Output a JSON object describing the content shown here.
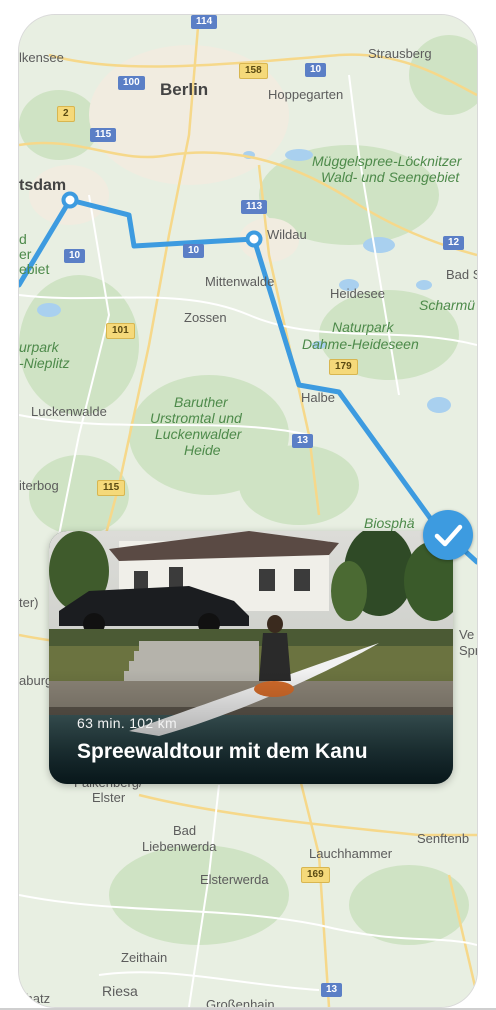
{
  "map": {
    "places": {
      "berlin": "Berlin",
      "falkensee": "lkensee",
      "strausberg": "Strausberg",
      "hoppegarten": "Hoppegarten",
      "muggelspree1": "Müggelspree-Löcknitzer",
      "muggelspree2": "Wald- und Seengebiet",
      "potsdam": "tsdam",
      "wildau": "Wildau",
      "mittenwalde": "Mittenwalde",
      "heidesee": "Heidesee",
      "badsa": "Bad S",
      "scharmu": "Scharmü",
      "zossen": "Zossen",
      "naturpark1": "Naturpark",
      "naturpark2": "Dahme-Heideseen",
      "nuthe1": "urpark",
      "nuthe2": "-Nieplitz",
      "luckenwalde": "Luckenwalde",
      "baruther1": "Baruther",
      "baruther2": "Urstromtal und",
      "baruther3": "Luckenwalder",
      "baruther4": "Heide",
      "halbe": "Halbe",
      "juterbog": "iterbog",
      "biosph": "Biosphä",
      "left_d": "d",
      "left_er": "er",
      "left_ebiet": "ebiet",
      "left_ter": "ter)",
      "left_burg": "aburg",
      "ve": "Ve",
      "spr": "Spr",
      "falkenberg": "Falkenberg/",
      "elster": "Elster",
      "bad": "Bad",
      "liebenwerda": "Liebenwerda",
      "lauchhammer": "Lauchhammer",
      "senftenb": "Senftenb",
      "elsterwerda": "Elsterwerda",
      "zeithain": "Zeithain",
      "riesa": "Riesa",
      "grossenhain": "Großenhain",
      "schatz": "chatz"
    },
    "shields": {
      "r114": "114",
      "r100": "100",
      "r158": "158",
      "r10a": "10",
      "r2": "2",
      "r115a": "115",
      "r113": "113",
      "r10b": "10",
      "r10c": "10",
      "r12": "12",
      "r101": "101",
      "r179": "179",
      "r13a": "13",
      "r115b": "115",
      "r169": "169",
      "r13b": "13"
    }
  },
  "card": {
    "meta": "63 min.  102 km",
    "title": "Spreewaldtour mit dem Kanu"
  },
  "colors": {
    "route": "#3d9be0",
    "accent": "#3d9be0",
    "map_bg": "#e7eee1"
  },
  "icons": {
    "selected": "checkmark-icon"
  }
}
